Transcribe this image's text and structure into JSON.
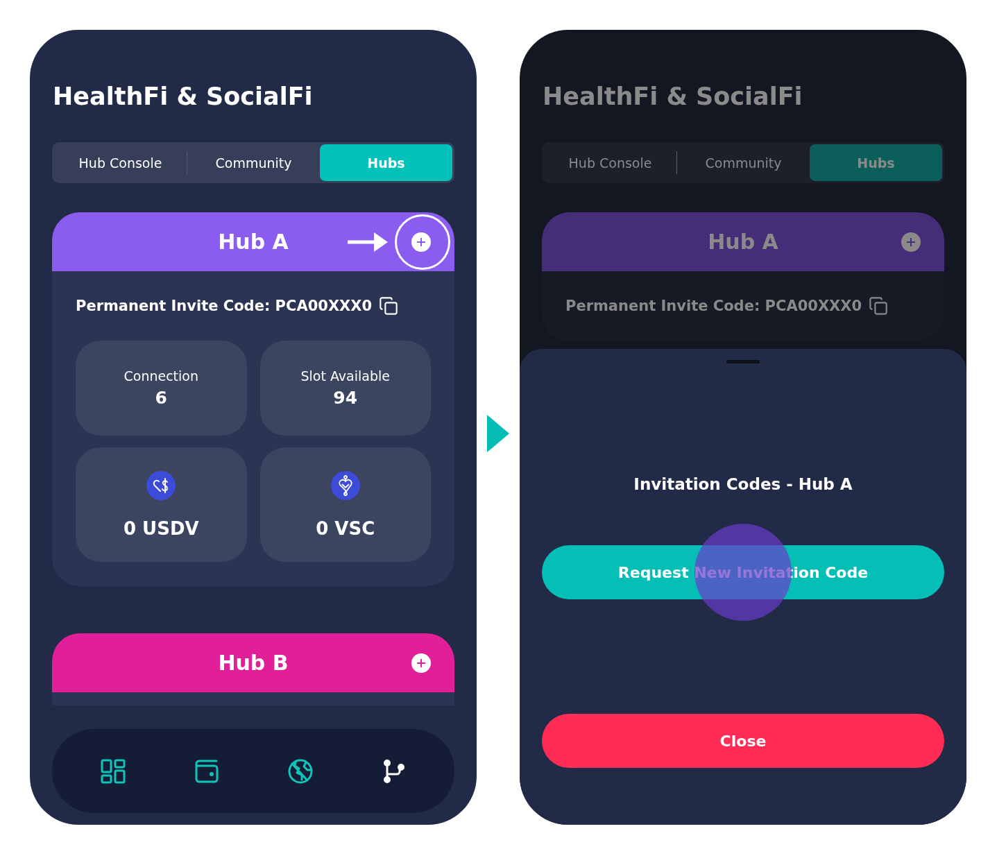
{
  "screens": [
    {
      "dimmed": false,
      "title": "HealthFi & SocialFi",
      "tabs": [
        {
          "label": "Hub Console",
          "selected": false
        },
        {
          "label": "Community",
          "selected": false
        },
        {
          "label": "Hubs",
          "selected": true
        }
      ],
      "hubs": [
        {
          "name": "Hub A",
          "color": "#8b5cf0",
          "highlighted": true,
          "expanded": true,
          "invite": "Permanent Invite Code: PCA00XXX0",
          "stats": [
            {
              "label": "Connection",
              "value": "6"
            },
            {
              "label": "Slot Available",
              "value": "94"
            }
          ],
          "balances": [
            {
              "kind": "usdv",
              "amount": "0 USDV"
            },
            {
              "kind": "vsc",
              "amount": "0 VSC"
            }
          ]
        },
        {
          "name": "Hub B",
          "color": "#e01f98",
          "highlighted": false,
          "expanded": false
        }
      ],
      "nav": [
        {
          "kind": "grid",
          "selected": false
        },
        {
          "kind": "wallet",
          "selected": false
        },
        {
          "kind": "globe",
          "selected": false
        },
        {
          "kind": "branch",
          "selected": true
        }
      ]
    },
    {
      "dimmed": true,
      "title": "HealthFi & SocialFi",
      "tabs": [
        {
          "label": "Hub Console",
          "selected": false
        },
        {
          "label": "Community",
          "selected": false
        },
        {
          "label": "Hubs",
          "selected": true
        }
      ],
      "hubs": [
        {
          "name": "Hub A",
          "color": "#462d78",
          "highlighted": false,
          "expanded": true,
          "invite": "Permanent Invite Code: PCA00XXX0"
        }
      ],
      "sheet": {
        "title": "Invitation Codes - Hub A",
        "buttons": [
          {
            "kind": "primary",
            "label": "Request New Invitation Code",
            "pressed": true
          },
          {
            "kind": "danger",
            "label": "Close",
            "pressed": false
          }
        ]
      }
    }
  ]
}
